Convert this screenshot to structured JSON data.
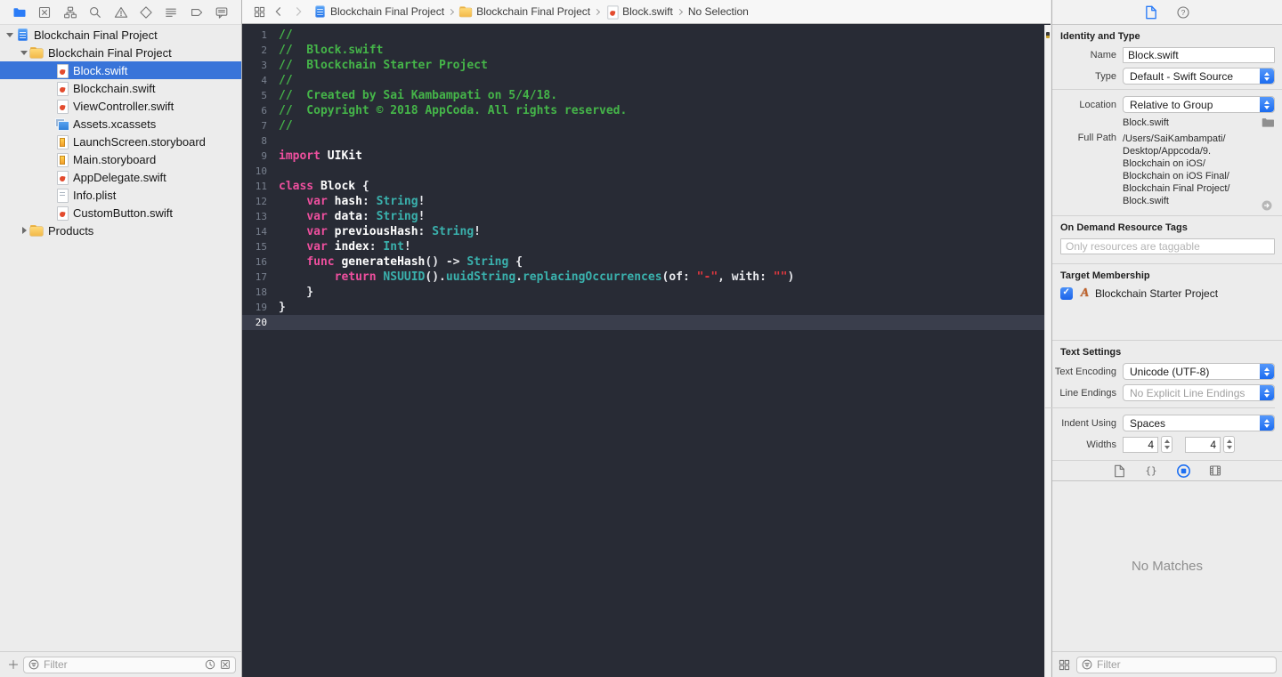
{
  "colors": {
    "accent_blue": "#2b7cf7",
    "selection_blue": "#3874d9",
    "editor_background": "#282b35",
    "editor_current_line": "#3a3e4c",
    "syntax_comment": "#45b549",
    "syntax_keyword": "#ee4f9e",
    "syntax_type": "#3ab1ad",
    "syntax_string": "#e0383f",
    "syntax_plain": "#e7e8ec",
    "panel_background": "#ececec"
  },
  "navigator": {
    "tabs": [
      {
        "name": "project-navigator",
        "selected": true
      },
      {
        "name": "source-control-navigator",
        "selected": false
      },
      {
        "name": "symbol-navigator",
        "selected": false
      },
      {
        "name": "find-navigator",
        "selected": false
      },
      {
        "name": "issue-navigator",
        "selected": false
      },
      {
        "name": "test-navigator",
        "selected": false
      },
      {
        "name": "debug-navigator",
        "selected": false
      },
      {
        "name": "breakpoint-navigator",
        "selected": false
      },
      {
        "name": "report-navigator",
        "selected": false
      }
    ],
    "tree": [
      {
        "label": "Blockchain Final Project",
        "depth": 0,
        "icon": "project",
        "disclosure": "expanded"
      },
      {
        "label": "Blockchain Final Project",
        "depth": 1,
        "icon": "folder",
        "disclosure": "expanded"
      },
      {
        "label": "Block.swift",
        "depth": 2,
        "icon": "swift",
        "selected": true
      },
      {
        "label": "Blockchain.swift",
        "depth": 2,
        "icon": "swift"
      },
      {
        "label": "ViewController.swift",
        "depth": 2,
        "icon": "swift"
      },
      {
        "label": "Assets.xcassets",
        "depth": 2,
        "icon": "assets"
      },
      {
        "label": "LaunchScreen.storyboard",
        "depth": 2,
        "icon": "storyboard"
      },
      {
        "label": "Main.storyboard",
        "depth": 2,
        "icon": "storyboard"
      },
      {
        "label": "AppDelegate.swift",
        "depth": 2,
        "icon": "swift"
      },
      {
        "label": "Info.plist",
        "depth": 2,
        "icon": "plist"
      },
      {
        "label": "CustomButton.swift",
        "depth": 2,
        "icon": "swift"
      },
      {
        "label": "Products",
        "depth": 1,
        "icon": "folder",
        "disclosure": "collapsed"
      }
    ],
    "filter": {
      "placeholder": "Filter"
    }
  },
  "editor": {
    "breadcrumbs": [
      {
        "icon": "project",
        "label": "Blockchain Final Project"
      },
      {
        "icon": "folder",
        "label": "Blockchain Final Project"
      },
      {
        "icon": "swift",
        "label": "Block.swift"
      },
      {
        "icon": "none",
        "label": "No Selection"
      }
    ],
    "current_line": 20,
    "lines": [
      {
        "tokens": [
          [
            "c",
            "//"
          ]
        ]
      },
      {
        "tokens": [
          [
            "c",
            "//  Block.swift"
          ]
        ]
      },
      {
        "tokens": [
          [
            "c",
            "//  Blockchain Starter Project"
          ]
        ]
      },
      {
        "tokens": [
          [
            "c",
            "//"
          ]
        ]
      },
      {
        "tokens": [
          [
            "c",
            "//  Created by Sai Kambampati on 5/4/18."
          ]
        ]
      },
      {
        "tokens": [
          [
            "c",
            "//  Copyright © 2018 AppCoda. All rights reserved."
          ]
        ]
      },
      {
        "tokens": [
          [
            "c",
            "//"
          ]
        ]
      },
      {
        "tokens": []
      },
      {
        "tokens": [
          [
            "k",
            "import"
          ],
          [
            "d",
            " UIKit"
          ]
        ]
      },
      {
        "tokens": []
      },
      {
        "tokens": [
          [
            "k",
            "class"
          ],
          [
            "d",
            " Block"
          ],
          [
            "p",
            " {"
          ]
        ]
      },
      {
        "tokens": [
          [
            "p",
            "    "
          ],
          [
            "k",
            "var"
          ],
          [
            "d",
            " hash"
          ],
          [
            "p",
            ": "
          ],
          [
            "t",
            "String"
          ],
          [
            "p",
            "!"
          ]
        ]
      },
      {
        "tokens": [
          [
            "p",
            "    "
          ],
          [
            "k",
            "var"
          ],
          [
            "d",
            " data"
          ],
          [
            "p",
            ": "
          ],
          [
            "t",
            "String"
          ],
          [
            "p",
            "!"
          ]
        ]
      },
      {
        "tokens": [
          [
            "p",
            "    "
          ],
          [
            "k",
            "var"
          ],
          [
            "d",
            " previousHash"
          ],
          [
            "p",
            ": "
          ],
          [
            "t",
            "String"
          ],
          [
            "p",
            "!"
          ]
        ]
      },
      {
        "tokens": [
          [
            "p",
            "    "
          ],
          [
            "k",
            "var"
          ],
          [
            "d",
            " index"
          ],
          [
            "p",
            ": "
          ],
          [
            "t",
            "Int"
          ],
          [
            "p",
            "!"
          ]
        ]
      },
      {
        "tokens": [
          [
            "p",
            "    "
          ],
          [
            "k",
            "func"
          ],
          [
            "d",
            " generateHash"
          ],
          [
            "p",
            "() -> "
          ],
          [
            "t",
            "String"
          ],
          [
            "p",
            " {"
          ]
        ]
      },
      {
        "tokens": [
          [
            "p",
            "        "
          ],
          [
            "k",
            "return"
          ],
          [
            "p",
            " "
          ],
          [
            "t",
            "NSUUID"
          ],
          [
            "p",
            "()."
          ],
          [
            "t",
            "uuidString"
          ],
          [
            "p",
            "."
          ],
          [
            "t",
            "replacingOccurrences"
          ],
          [
            "p",
            "(of: "
          ],
          [
            "s",
            "\"-\""
          ],
          [
            "p",
            ", with: "
          ],
          [
            "s",
            "\"\""
          ],
          [
            "p",
            ")"
          ]
        ]
      },
      {
        "tokens": [
          [
            "p",
            "    }"
          ]
        ]
      },
      {
        "tokens": [
          [
            "p",
            "}"
          ]
        ]
      },
      {
        "tokens": []
      }
    ]
  },
  "inspector": {
    "tabs": [
      {
        "name": "file-inspector",
        "selected": true
      },
      {
        "name": "quick-help-inspector",
        "selected": false
      }
    ],
    "identity": {
      "title": "Identity and Type",
      "name_label": "Name",
      "name_value": "Block.swift",
      "type_label": "Type",
      "type_value": "Default - Swift Source",
      "location_label": "Location",
      "location_value": "Relative to Group",
      "location_file": "Block.swift",
      "full_path_label": "Full Path",
      "full_path_lines": [
        "/Users/SaiKambampati/",
        "Desktop/Appcoda/9.",
        "Blockchain on iOS/",
        "Blockchain on iOS Final/",
        "Blockchain Final Project/",
        "Block.swift"
      ]
    },
    "resource_tags": {
      "title": "On Demand Resource Tags",
      "placeholder": "Only resources are taggable"
    },
    "target_membership": {
      "title": "Target Membership",
      "targets": [
        {
          "label": "Blockchain Starter Project",
          "checked": true
        }
      ]
    },
    "text_settings": {
      "title": "Text Settings",
      "rows": [
        {
          "label": "Text Encoding",
          "value": "Unicode (UTF-8)",
          "disabled": false
        },
        {
          "label": "Line Endings",
          "value": "No Explicit Line Endings",
          "disabled": true
        },
        {
          "label": "Indent Using",
          "value": "Spaces",
          "disabled": false
        }
      ],
      "widths_label": "Widths",
      "width_values": [
        "4",
        "4"
      ]
    },
    "library": {
      "tabs": [
        {
          "name": "file-template-library",
          "selected": false
        },
        {
          "name": "code-snippet-library",
          "selected": false
        },
        {
          "name": "object-library",
          "selected": true
        },
        {
          "name": "media-library",
          "selected": false
        }
      ],
      "empty_text": "No Matches",
      "filter_placeholder": "Filter"
    }
  }
}
